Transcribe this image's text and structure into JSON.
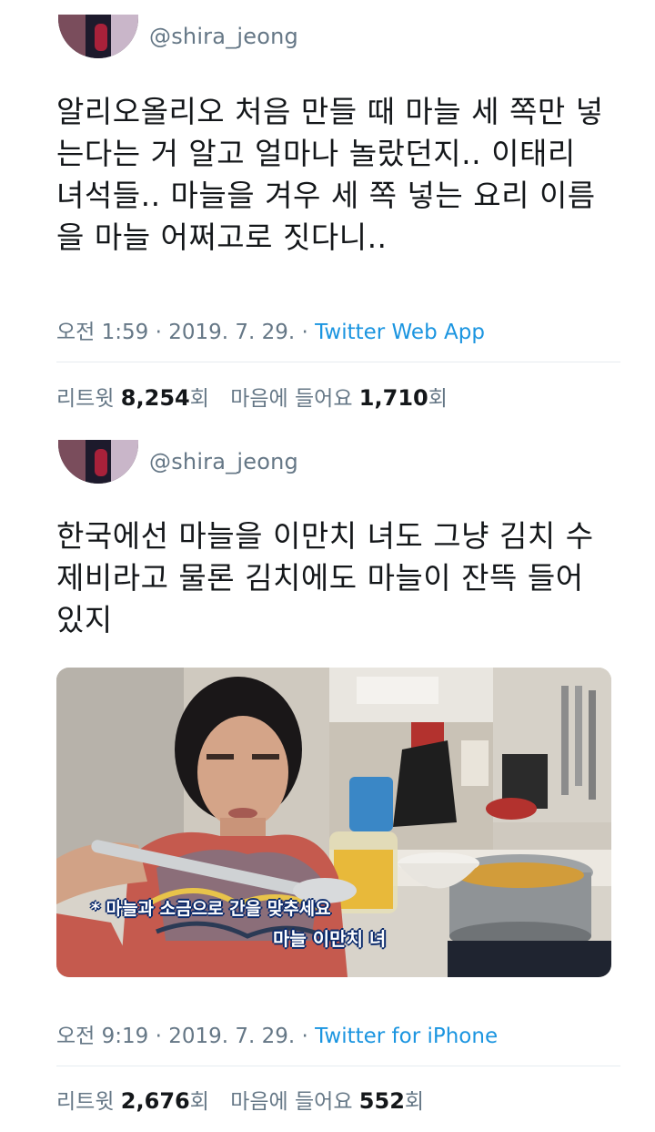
{
  "tweets": [
    {
      "handle": "@shira_jeong",
      "text": "알리오올리오 처음 만들 때 마늘 세 쪽만 넣\n는다는 거 알고 얼마나 놀랐던지.. 이태리\n녀석들.. 마늘을 겨우 세 쪽 넣는 요리 이름\n을 마늘 어쩌고로 짓다니..",
      "time": "오전 1:59 · 2019. 7. 29. · ",
      "source": "Twitter Web App",
      "retweet_label": "리트윗",
      "retweet_count": "8,254",
      "count_suffix": "회",
      "like_label": "마음에 들어요",
      "like_count": "1,710"
    },
    {
      "handle": "@shira_jeong",
      "text": "한국에선 마늘을 이만치 녀도 그냥 김치 수\n제비라고 물론 김치에도 마늘이 잔뜩 들어\n있지",
      "time": "오전 9:19 · 2019. 7. 29. · ",
      "source": "Twitter for iPhone",
      "retweet_label": "리트윗",
      "retweet_count": "2,676",
      "count_suffix": "회",
      "like_label": "마음에 들어요",
      "like_count": "552",
      "media": {
        "subtitle_1": "* 마늘과 소금으로 간을 맞추세요",
        "subtitle_2": "마늘 이만치 녀"
      }
    }
  ],
  "colors": {
    "text": "#14171a",
    "secondary": "#657786",
    "link": "#1b95e0",
    "divider": "#e6ecf0"
  }
}
